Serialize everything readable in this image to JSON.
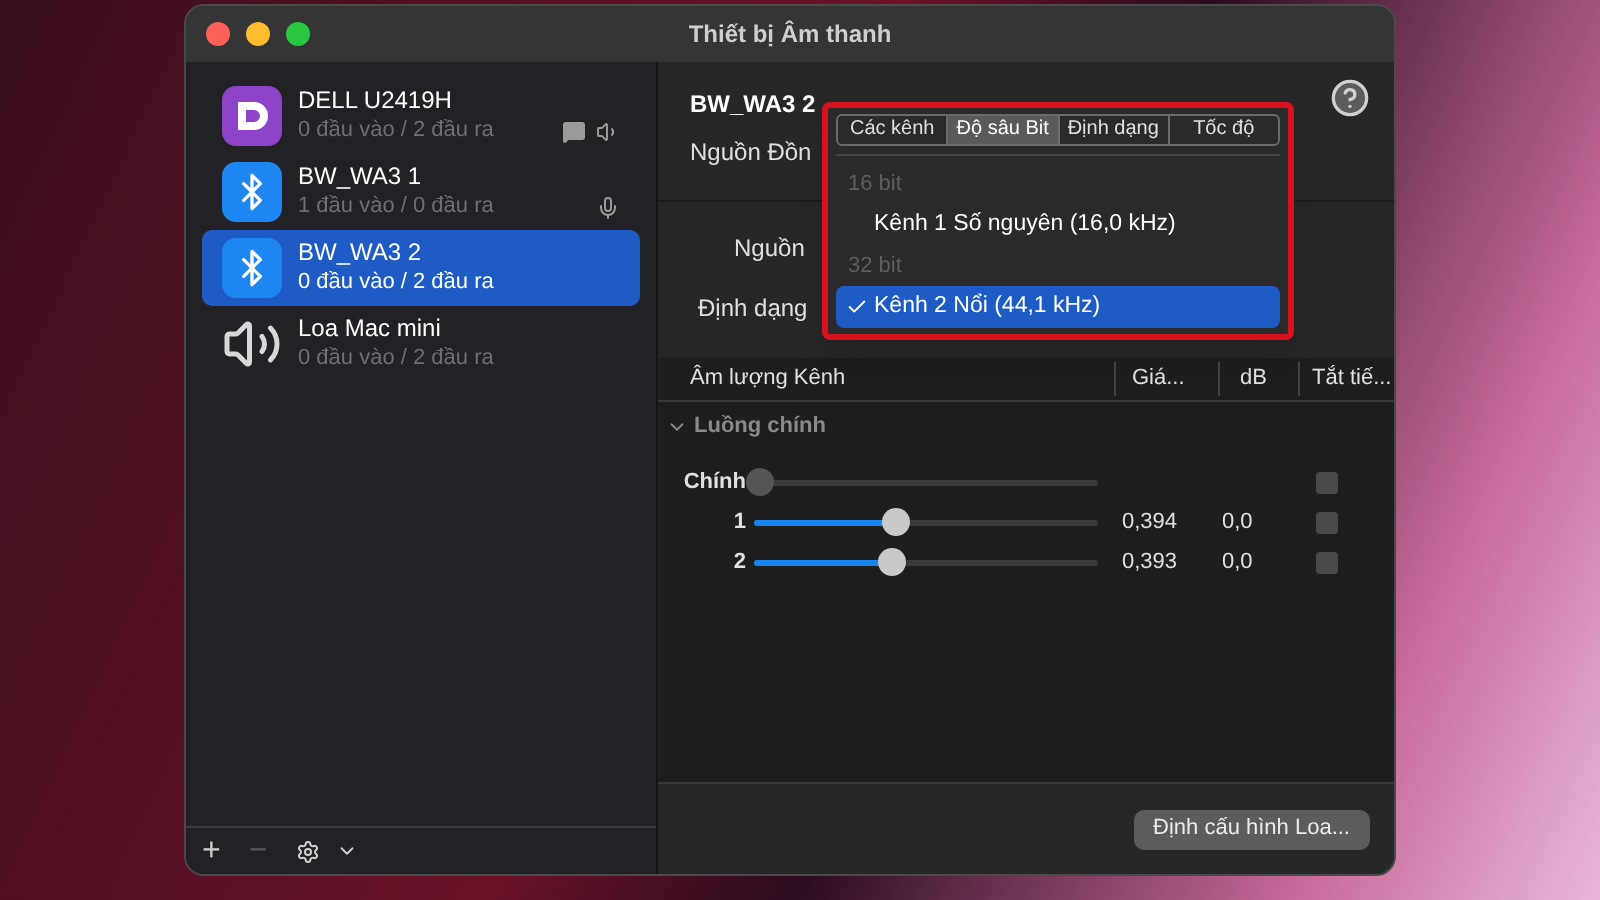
{
  "window": {
    "title": "Thiết bị Âm thanh"
  },
  "devices": [
    {
      "kind": "display",
      "name": "DELL U2419H",
      "io": "0 đầu vào / 2 đầu ra",
      "selected": false
    },
    {
      "kind": "bluetooth",
      "name": "BW_WA3 1",
      "io": "1 đầu vào / 0 đầu ra",
      "selected": false
    },
    {
      "kind": "bluetooth",
      "name": "BW_WA3 2",
      "io": "0 đầu vào / 2 đầu ra",
      "selected": true
    },
    {
      "kind": "builtin",
      "name": "Loa Mac mini",
      "io": "0 đầu vào / 2 đầu ra",
      "selected": false
    }
  ],
  "sidebar_toolbar": {
    "add": "+",
    "remove": "−"
  },
  "detail": {
    "device_name": "BW_WA3 2",
    "clock_label": "Nguồn Đồn",
    "source_label": "Nguồn",
    "format_label": "Định dạng"
  },
  "format_menu": {
    "tabs": [
      {
        "label": "Các kênh",
        "selected": false
      },
      {
        "label": "Độ sâu Bit",
        "selected": true
      },
      {
        "label": "Định dạng",
        "selected": false
      },
      {
        "label": "Tốc độ",
        "selected": false
      }
    ],
    "items": [
      {
        "kind": "header",
        "label": "16 bit",
        "selected": false
      },
      {
        "kind": "option",
        "label": "Kênh 1 Số nguyên (16,0 kHz)",
        "selected": false
      },
      {
        "kind": "header",
        "label": "32 bit",
        "selected": false
      },
      {
        "kind": "option",
        "label": "Kênh 2 Nổi (44,1 kHz)",
        "selected": true
      }
    ]
  },
  "volume_table": {
    "columns": [
      "Âm lượng Kênh",
      "Giá...",
      "dB",
      "Tắt tiế..."
    ],
    "section": {
      "label": "Luồng chính",
      "expanded": true
    },
    "rows": [
      {
        "name": "Chính",
        "level": 0.02,
        "value": "",
        "db": "",
        "muted": false
      },
      {
        "name": "1",
        "level": 0.41,
        "value": "0,394",
        "db": "0,0",
        "muted": false
      },
      {
        "name": "2",
        "level": 0.4,
        "value": "0,393",
        "db": "0,0",
        "muted": false
      }
    ]
  },
  "configure_button": "Định cấu hình Loa..."
}
